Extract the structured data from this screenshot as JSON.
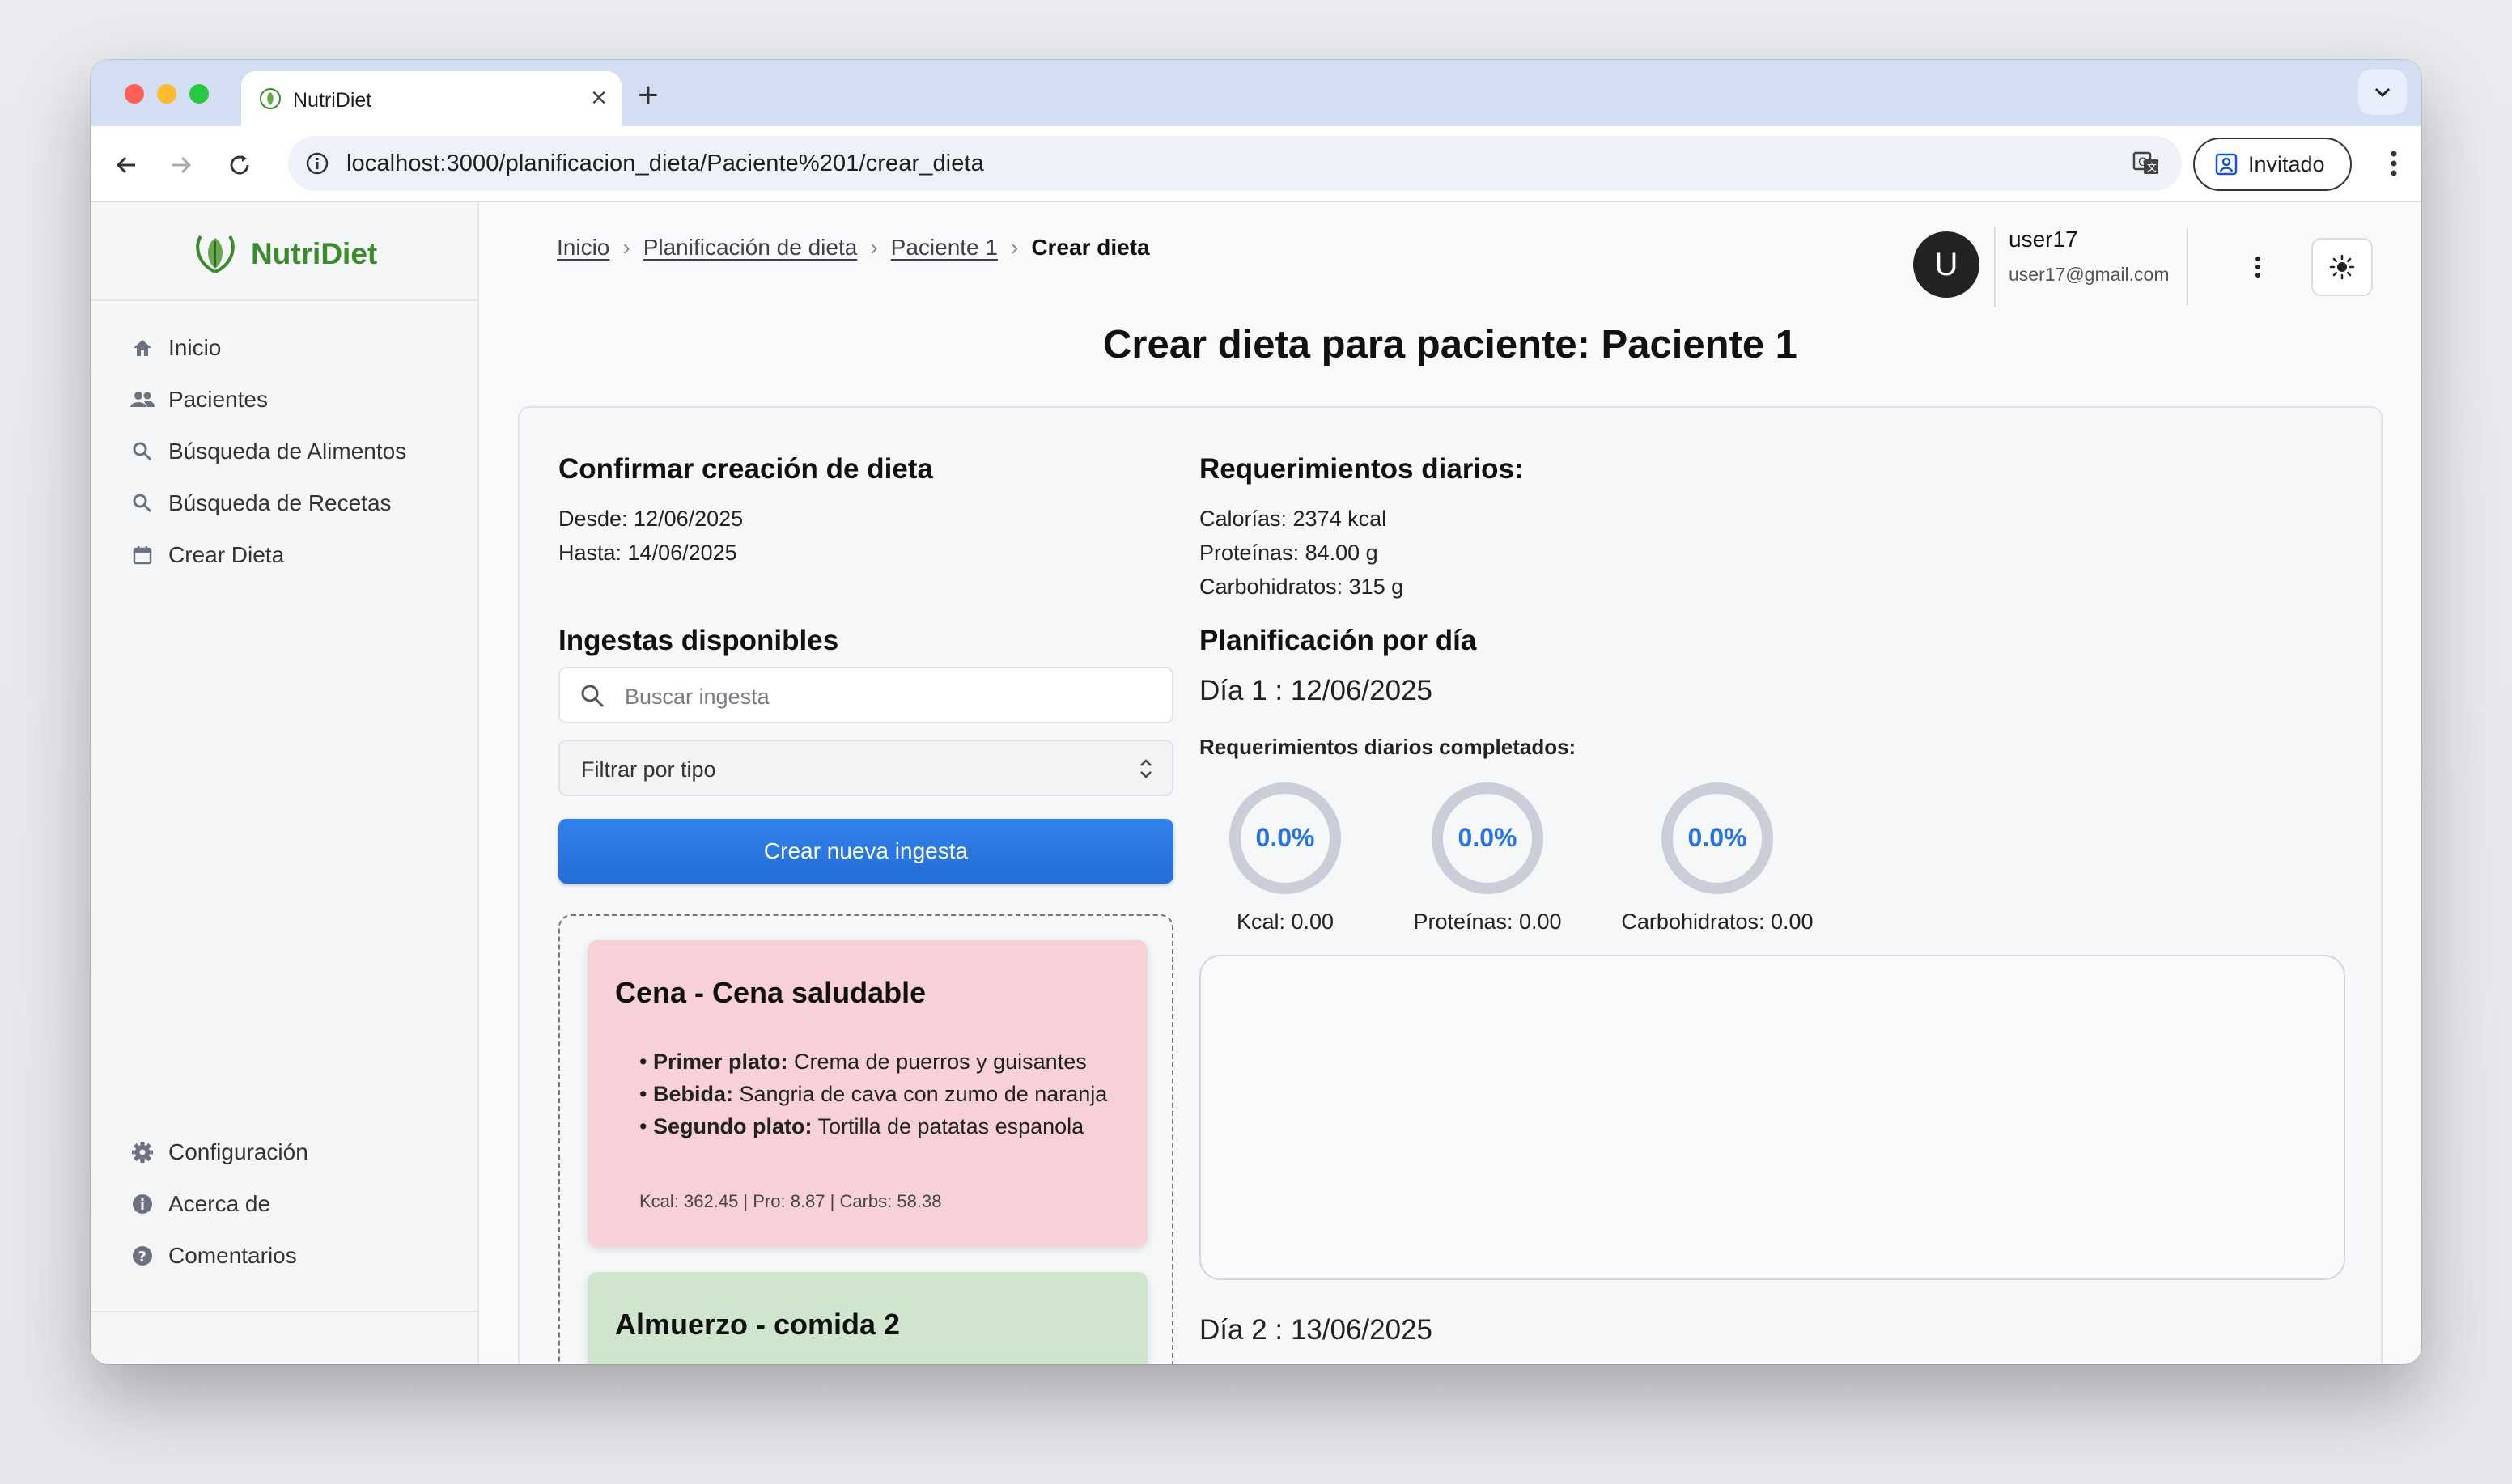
{
  "browser": {
    "tab_title": "NutriDiet",
    "url": "localhost:3000/planificacion_dieta/Paciente%201/crear_dieta",
    "profile_label": "Invitado"
  },
  "sidebar": {
    "brand": "NutriDiet",
    "items": [
      {
        "label": "Inicio",
        "icon": "home-icon"
      },
      {
        "label": "Pacientes",
        "icon": "people-icon"
      },
      {
        "label": "Búsqueda de Alimentos",
        "icon": "search-icon"
      },
      {
        "label": "Búsqueda de Recetas",
        "icon": "search-icon"
      },
      {
        "label": "Crear Dieta",
        "icon": "calendar-icon"
      }
    ],
    "bottom_items": [
      {
        "label": "Configuración",
        "icon": "gear-icon"
      },
      {
        "label": "Acerca de",
        "icon": "info-icon"
      },
      {
        "label": "Comentarios",
        "icon": "help-icon"
      }
    ]
  },
  "breadcrumb": {
    "items": [
      "Inicio",
      "Planificación de dieta",
      "Paciente 1"
    ],
    "current": "Crear dieta"
  },
  "user": {
    "initial": "U",
    "name": "user17",
    "email": "user17@gmail.com"
  },
  "page_title": "Crear dieta para paciente: Paciente 1",
  "confirm": {
    "heading": "Confirmar creación de dieta",
    "desde": "Desde: 12/06/2025",
    "hasta": "Hasta: 14/06/2025"
  },
  "requirements": {
    "heading": "Requerimientos diarios:",
    "calorias": "Calorías: 2374 kcal",
    "proteinas": "Proteínas: 84.00 g",
    "carbohidratos": "Carbohidratos: 315 g"
  },
  "ingestas": {
    "heading": "Ingestas disponibles",
    "search_placeholder": "Buscar ingesta",
    "filter_value": "Filtrar por tipo",
    "create_button": "Crear nueva ingesta",
    "meals": [
      {
        "title": "Cena - Cena saludable",
        "items": [
          {
            "label": "Primer plato:",
            "value": "Crema de puerros y guisantes"
          },
          {
            "label": "Bebida:",
            "value": "Sangria de cava con zumo de naranja"
          },
          {
            "label": "Segundo plato:",
            "value": "Tortilla de patatas espanola"
          }
        ],
        "macros": "Kcal: 362.45 | Pro: 8.87 | Carbs: 58.38",
        "color": "#f8d0d7"
      },
      {
        "title": "Almuerzo - comida 2",
        "color": "#d0e5cd"
      }
    ]
  },
  "planning": {
    "heading": "Planificación por día",
    "day1": "Día 1 : 12/06/2025",
    "completed_heading": "Requerimientos diarios completados:",
    "rings": [
      {
        "value": "0.0%",
        "fraction": 0.0,
        "label": "Kcal: 0.00"
      },
      {
        "value": "0.0%",
        "fraction": 0.0,
        "label": "Proteínas: 0.00"
      },
      {
        "value": "0.0%",
        "fraction": 0.0,
        "label": "Carbohidratos: 0.00"
      }
    ],
    "day2": "Día 2 : 13/06/2025"
  },
  "colors": {
    "brand_green": "#3b8a2e",
    "primary_blue": "#2a74de",
    "ring_track": "#c9ced8",
    "ring_text": "#2a74de"
  }
}
